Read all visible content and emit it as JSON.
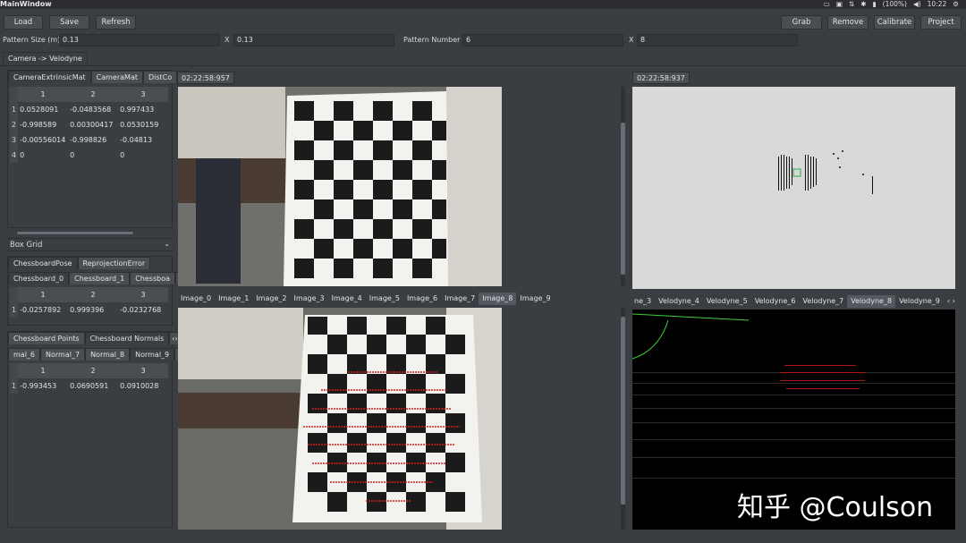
{
  "window": {
    "title": "MainWindow"
  },
  "tray": {
    "battery": "(100%)",
    "clock": "10:22"
  },
  "toolbar": {
    "load": "Load",
    "save": "Save",
    "refresh": "Refresh",
    "grab": "Grab",
    "remove": "Remove",
    "calibrate": "Calibrate",
    "project": "Project"
  },
  "params": {
    "pattern_size_label": "Pattern Size (m)",
    "pattern_size_w": "0.13",
    "x1": "X",
    "pattern_size_h": "0.13",
    "pattern_number_label": "Pattern Number",
    "pattern_number_w": "6",
    "x2": "X",
    "pattern_number_h": "8"
  },
  "main_tab": "Camera -> Velodyne",
  "extrinsic": {
    "tabs": [
      "CameraExtrinsicMat",
      "CameraMat",
      "DistCo"
    ],
    "headers": [
      "1",
      "2",
      "3"
    ],
    "rows": [
      {
        "n": "1",
        "c": [
          "0.0528091",
          "-0.0483568",
          "0.997433"
        ]
      },
      {
        "n": "2",
        "c": [
          "-0.998589",
          "0.00300417",
          "0.0530159"
        ]
      },
      {
        "n": "3",
        "c": [
          "-0.00556014",
          "-0.998826",
          "-0.04813"
        ]
      },
      {
        "n": "4",
        "c": [
          "0",
          "0",
          "0"
        ]
      }
    ]
  },
  "box_grid": "Box Grid",
  "pose": {
    "tabs": [
      "ChessboardPose",
      "ReprojectionError"
    ],
    "subtabs": [
      "Chessboard_0",
      "Chessboard_1",
      "Chessboa"
    ],
    "headers": [
      "1",
      "2",
      "3"
    ],
    "row": {
      "n": "1",
      "c": [
        "-0.0257892",
        "0.999396",
        "-0.0232768"
      ]
    }
  },
  "normals": {
    "tabs": [
      "Chessboard Points",
      "Chessboard Normals"
    ],
    "subtabs": [
      "mal_6",
      "Normal_7",
      "Normal_8",
      "Normal_9"
    ],
    "headers": [
      "1",
      "2",
      "3"
    ],
    "row": {
      "n": "1",
      "c": [
        "-0.993453",
        "0.0690591",
        "0.0910028"
      ]
    }
  },
  "camera_view": {
    "timestamp": "02:22:58:957"
  },
  "lidar_view": {
    "timestamp": "02:22:58:937"
  },
  "image_tabs": [
    "Image_0",
    "Image_1",
    "Image_2",
    "Image_3",
    "Image_4",
    "Image_5",
    "Image_6",
    "Image_7",
    "Image_8",
    "Image_9"
  ],
  "image_tab_selected": 8,
  "velodyne_tabs": [
    "ne_3",
    "Velodyne_4",
    "Velodyne_5",
    "Velodyne_6",
    "Velodyne_7",
    "Velodyne_8",
    "Velodyne_9"
  ],
  "velodyne_tab_selected": 5,
  "watermark": "知乎 @Coulson"
}
